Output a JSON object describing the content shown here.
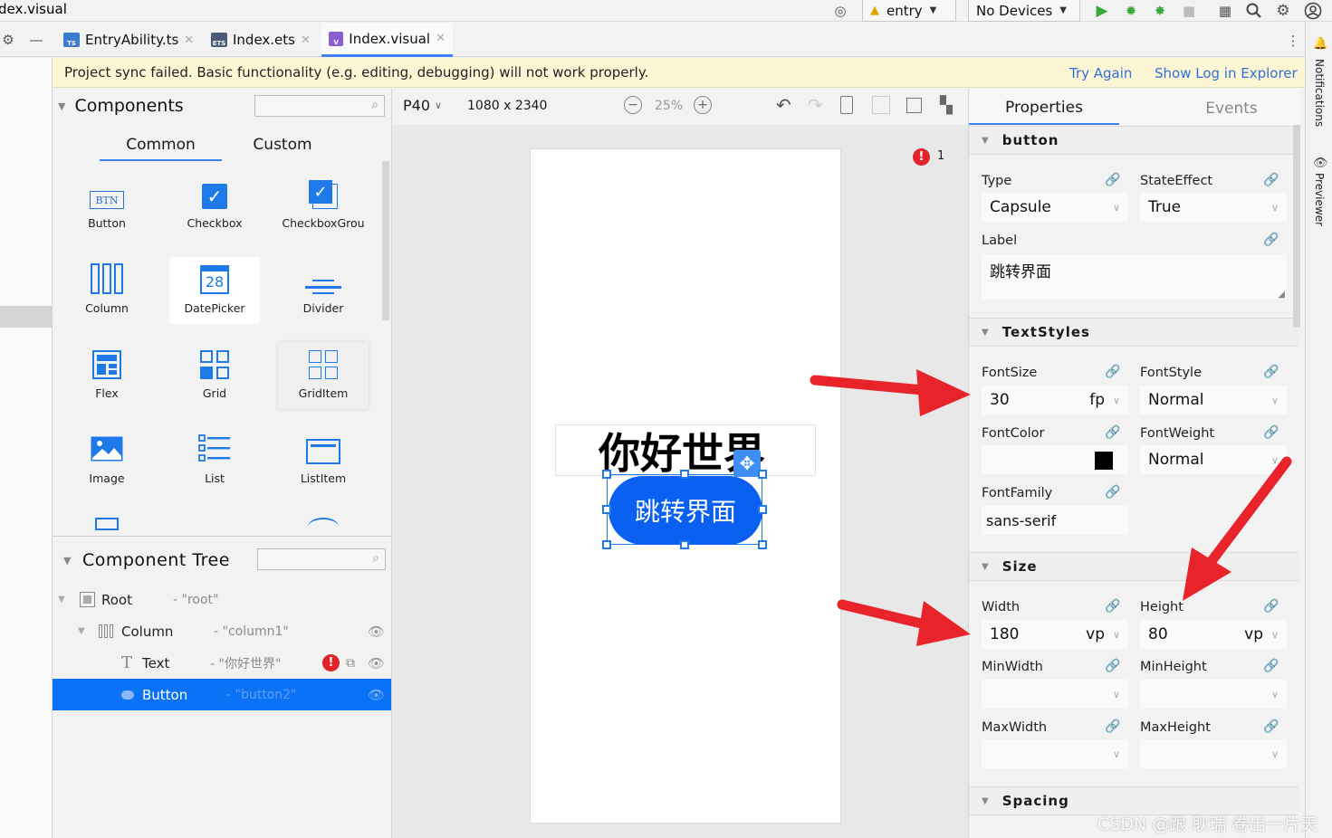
{
  "window_title": "dex.visual",
  "toolbar": {
    "module_select": "entry",
    "device_select": "No Devices"
  },
  "file_tabs": [
    {
      "label": "EntryAbility.ts",
      "icon": "TS"
    },
    {
      "label": "Index.ets",
      "icon": "ETS"
    },
    {
      "label": "Index.visual",
      "icon": "V"
    }
  ],
  "banner": {
    "message": "Project sync failed. Basic functionality (e.g. editing, debugging) will not work properly.",
    "try_again": "Try Again",
    "show_log": "Show Log in Explorer"
  },
  "components_panel": {
    "title": "Components",
    "tabs": [
      "Common",
      "Custom"
    ],
    "items": [
      "Button",
      "Checkbox",
      "CheckboxGrou",
      "Column",
      "DatePicker",
      "Divider",
      "Flex",
      "Grid",
      "GridItem",
      "Image",
      "List",
      "ListItem"
    ],
    "button_icon_text": "BTN",
    "datepicker_icon_text": "28"
  },
  "component_tree": {
    "title": "Component Tree",
    "rows": [
      {
        "type": "Root",
        "id": "- \"root\""
      },
      {
        "type": "Column",
        "id": "- \"column1\""
      },
      {
        "type": "Text",
        "id": "- \"你好世界\""
      },
      {
        "type": "Button",
        "id": "- \"button2\""
      }
    ]
  },
  "canvas": {
    "device": "P40",
    "resolution": "1080 x 2340",
    "zoom": "25%",
    "error_count": "1",
    "text_content": "你好世界",
    "button_label": "跳转界面"
  },
  "properties": {
    "tabs": [
      "Properties",
      "Events"
    ],
    "sections": {
      "button": "button",
      "textstyles": "TextStyles",
      "size": "Size",
      "spacing": "Spacing"
    },
    "type_label": "Type",
    "type_value": "Capsule",
    "stateeffect_label": "StateEffect",
    "stateeffect_value": "True",
    "label_label": "Label",
    "label_value": "跳转界面",
    "fontsize_label": "FontSize",
    "fontsize_value": "30",
    "fontsize_unit": "fp",
    "fontstyle_label": "FontStyle",
    "fontstyle_value": "Normal",
    "fontcolor_label": "FontColor",
    "fontweight_label": "FontWeight",
    "fontweight_value": "Normal",
    "fontfamily_label": "FontFamily",
    "fontfamily_value": "sans-serif",
    "width_label": "Width",
    "width_value": "180",
    "width_unit": "vp",
    "height_label": "Height",
    "height_value": "80",
    "height_unit": "vp",
    "minwidth_label": "MinWidth",
    "minheight_label": "MinHeight",
    "maxwidth_label": "MaxWidth",
    "maxheight_label": "MaxHeight"
  },
  "side_strip": {
    "notifications": "Notifications",
    "previewer": "Previewer"
  },
  "watermark": "CSDN @跟 耿瑞 卷出一片天",
  "colors": {
    "accent": "#0a73f5",
    "button_fill": "#0a60f0",
    "arrow": "#e8232a",
    "error": "#e0242a",
    "banner_bg": "#fdf6d5",
    "link": "#2f6fd6"
  }
}
